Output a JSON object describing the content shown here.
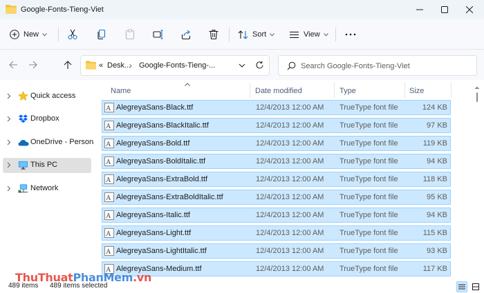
{
  "window": {
    "title": "Google-Fonts-Tieng-Viet",
    "controls": {
      "minimize": "minimize",
      "maximize": "maximize",
      "close": "close"
    }
  },
  "commandbar": {
    "new_label": "New",
    "sort_label": "Sort",
    "view_label": "View",
    "icons": [
      "cut-icon",
      "copy-icon",
      "paste-icon",
      "rename-icon",
      "share-icon",
      "delete-icon",
      "more-icon"
    ]
  },
  "address": {
    "overflow": "«",
    "crumb1": "Desk...",
    "crumb2": "Google-Fonts-Tieng-..."
  },
  "search": {
    "placeholder": "Search Google-Fonts-Tieng-Viet"
  },
  "sidebar": {
    "items": [
      {
        "label": "Quick access",
        "icon": "star-icon",
        "selected": false
      },
      {
        "label": "Dropbox",
        "icon": "dropbox-icon",
        "selected": false
      },
      {
        "label": "OneDrive - Personal",
        "icon": "onedrive-icon",
        "selected": false
      },
      {
        "label": "This PC",
        "icon": "this-pc-icon",
        "selected": true
      },
      {
        "label": "Network",
        "icon": "network-icon",
        "selected": false
      }
    ]
  },
  "columns": {
    "name": "Name",
    "date": "Date modified",
    "type": "Type",
    "size": "Size"
  },
  "files": [
    {
      "name": "AlegreyaSans-Black.ttf",
      "date": "12/4/2013 12:00 AM",
      "type": "TrueType font file",
      "size": "124 KB"
    },
    {
      "name": "AlegreyaSans-BlackItalic.ttf",
      "date": "12/4/2013 12:00 AM",
      "type": "TrueType font file",
      "size": "97 KB"
    },
    {
      "name": "AlegreyaSans-Bold.ttf",
      "date": "12/4/2013 12:00 AM",
      "type": "TrueType font file",
      "size": "119 KB"
    },
    {
      "name": "AlegreyaSans-BoldItalic.ttf",
      "date": "12/4/2013 12:00 AM",
      "type": "TrueType font file",
      "size": "94 KB"
    },
    {
      "name": "AlegreyaSans-ExtraBold.ttf",
      "date": "12/4/2013 12:00 AM",
      "type": "TrueType font file",
      "size": "118 KB"
    },
    {
      "name": "AlegreyaSans-ExtraBoldItalic.ttf",
      "date": "12/4/2013 12:00 AM",
      "type": "TrueType font file",
      "size": "95 KB"
    },
    {
      "name": "AlegreyaSans-Italic.ttf",
      "date": "12/4/2013 12:00 AM",
      "type": "TrueType font file",
      "size": "94 KB"
    },
    {
      "name": "AlegreyaSans-Light.ttf",
      "date": "12/4/2013 12:00 AM",
      "type": "TrueType font file",
      "size": "115 KB"
    },
    {
      "name": "AlegreyaSans-LightItalic.ttf",
      "date": "12/4/2013 12:00 AM",
      "type": "TrueType font file",
      "size": "93 KB"
    },
    {
      "name": "AlegreyaSans-Medium.ttf",
      "date": "12/4/2013 12:00 AM",
      "type": "TrueType font file",
      "size": "117 KB"
    }
  ],
  "status": {
    "item_count": "489 items",
    "selected_count": "489 items selected"
  },
  "watermark": {
    "part1": "ThuThuat",
    "part2": "PhanMem",
    "part3": ".vn"
  },
  "colors": {
    "selection_fill": "#cce8ff",
    "selection_border": "#99d1ff",
    "accent": "#0067c0",
    "folder": "#f3c13a"
  }
}
